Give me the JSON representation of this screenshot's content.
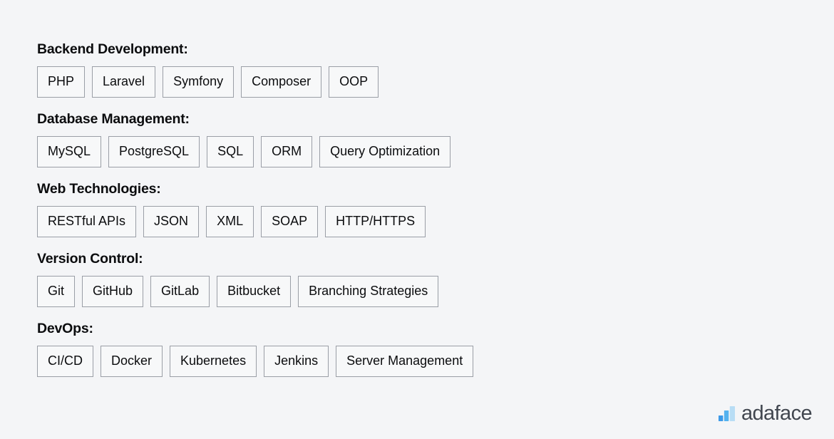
{
  "page": {
    "background_color": "#f4f5f7",
    "text_color": "#0b0c0e",
    "chip_border_color": "#9a9ea6",
    "chip_background_color": "#f7f8f9"
  },
  "skills": {
    "sections": [
      {
        "heading": "Backend Development:",
        "tags": [
          "PHP",
          "Laravel",
          "Symfony",
          "Composer",
          "OOP"
        ]
      },
      {
        "heading": "Database Management:",
        "tags": [
          "MySQL",
          "PostgreSQL",
          "SQL",
          "ORM",
          "Query Optimization"
        ]
      },
      {
        "heading": "Web Technologies:",
        "tags": [
          "RESTful APIs",
          "JSON",
          "XML",
          "SOAP",
          "HTTP/HTTPS"
        ]
      },
      {
        "heading": "Version Control:",
        "tags": [
          "Git",
          "GitHub",
          "GitLab",
          "Bitbucket",
          "Branching Strategies"
        ]
      },
      {
        "heading": "DevOps:",
        "tags": [
          "CI/CD",
          "Docker",
          "Kubernetes",
          "Jenkins",
          "Server Management"
        ]
      }
    ]
  },
  "brand": {
    "name": "adaface",
    "mark_icon": "bar-chart-icon",
    "mark_colors": {
      "bar_small": "#3d9ae8",
      "bar_medium": "#54b2ef",
      "bar_large": "#b8ddf5"
    },
    "wordmark_color": "#41464f"
  }
}
